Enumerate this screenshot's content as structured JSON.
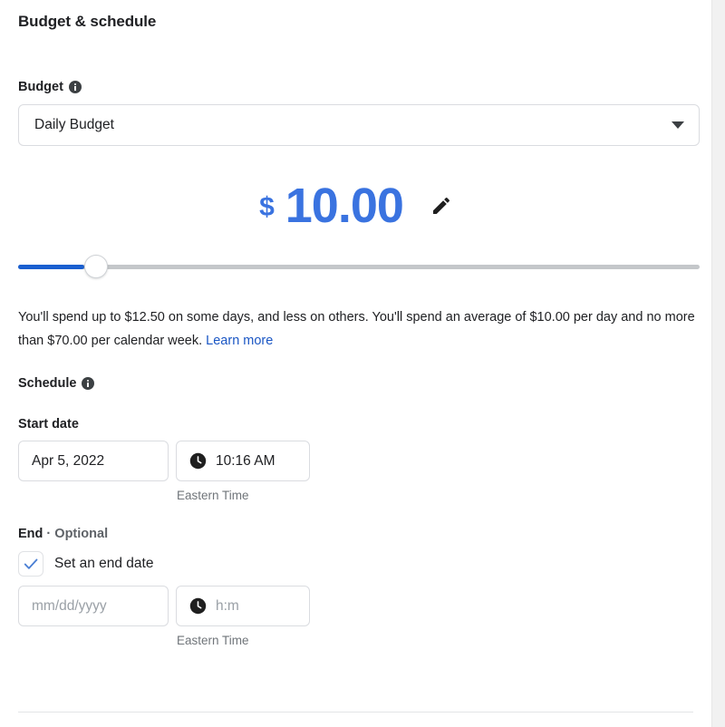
{
  "section": {
    "title": "Budget & schedule"
  },
  "budget": {
    "label": "Budget",
    "info_icon": "info-icon",
    "type_select": {
      "value": "Daily Budget",
      "caret_icon": "chevron-down-icon"
    },
    "currency_symbol": "$",
    "amount": "10.00",
    "edit_icon": "pencil-icon",
    "accent_color": "#3a73e0",
    "slider": {
      "fill_color": "#1a5fd0",
      "track_color": "#c4c7ca",
      "percent": 9.7
    },
    "helper": {
      "text_before_link": "You'll spend up to $12.50 on some days, and less on others. You'll spend an average of $10.00 per day and no more than $70.00 per calendar week. ",
      "link_label": "Learn more",
      "link_color": "#1a56c4",
      "max_daily": "$12.50",
      "average_daily": "$10.00",
      "max_weekly": "$70.00"
    }
  },
  "schedule": {
    "label": "Schedule",
    "info_icon": "info-icon",
    "start": {
      "label": "Start date",
      "date_value": "Apr 5, 2022",
      "date_placeholder": "mm/dd/yyyy",
      "time_value": "10:16 AM",
      "time_icon": "clock-icon",
      "timezone_note": "Eastern Time"
    },
    "end": {
      "label": "End",
      "separator": "·",
      "optional_label": "Optional",
      "checkbox": {
        "label": "Set an end date",
        "checked": true,
        "check_icon": "check-icon",
        "check_color": "#4a7fd4"
      },
      "date_value": "",
      "date_placeholder": "mm/dd/yyyy",
      "time_value": "",
      "time_placeholder": "h:m",
      "time_icon": "clock-icon",
      "timezone_note": "Eastern Time"
    }
  },
  "scrollbar": {
    "present": true
  }
}
